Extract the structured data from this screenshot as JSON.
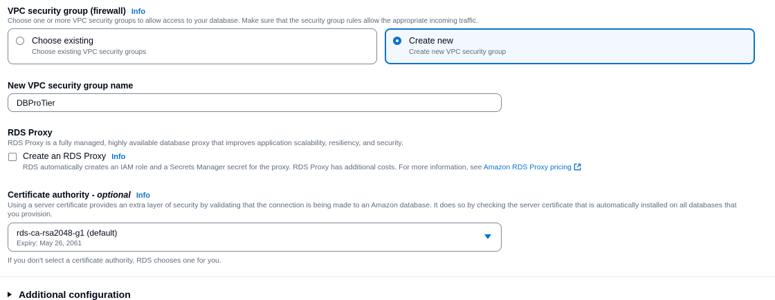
{
  "security_group": {
    "label": "VPC security group (firewall)",
    "info": "Info",
    "description": "Choose one or more VPC security groups to allow access to your database. Make sure that the security group rules allow the appropriate incoming traffic.",
    "options": [
      {
        "title": "Choose existing",
        "description": "Choose existing VPC security groups",
        "selected": false
      },
      {
        "title": "Create new",
        "description": "Create new VPC security group",
        "selected": true
      }
    ]
  },
  "new_sg_name": {
    "label": "New VPC security group name",
    "value": "DBProTier"
  },
  "rds_proxy": {
    "label": "RDS Proxy",
    "description": "RDS Proxy is a fully managed, highly available database proxy that improves application scalability, resiliency, and security.",
    "checkbox_label": "Create an RDS Proxy",
    "info": "Info",
    "checkbox_description": "RDS automatically creates an IAM role and a Secrets Manager secret for the proxy. RDS Proxy has additional costs. For more information, see",
    "link_text": "Amazon RDS Proxy pricing",
    "checked": false
  },
  "certificate": {
    "label": "Certificate authority",
    "optional": "optional",
    "info": "Info",
    "description": "Using a server certificate provides an extra layer of security by validating that the connection is being made to an Amazon database. It does so by checking the server certificate that is automatically installed on all databases that you provision.",
    "selected_value": "rds-ca-rsa2048-g1 (default)",
    "selected_sub": "Expiry: May 26, 2061",
    "constraint": "If you don't select a certificate authority, RDS chooses one for you."
  },
  "additional": {
    "label": "Additional configuration"
  },
  "colors": {
    "accent": "#0972d3",
    "text": "#000716",
    "secondary_text": "#5f6b7a",
    "border": "#7d8998",
    "selected_bg": "#f2f8fd"
  }
}
